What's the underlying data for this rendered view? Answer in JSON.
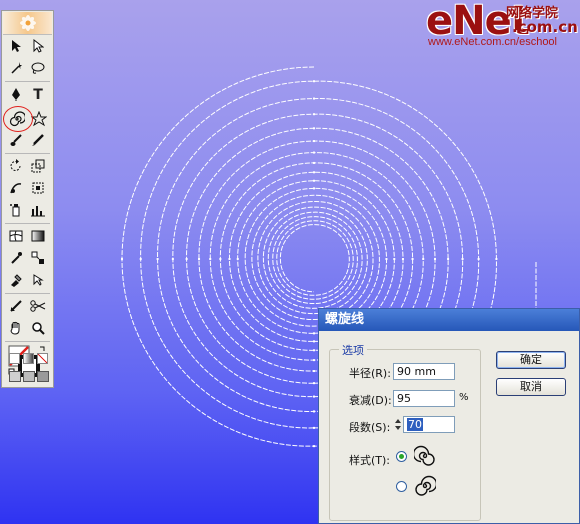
{
  "logo": {
    "brand": "eNet",
    "chinese": "网络学院",
    "domain": ".com.cn",
    "url": "www.eNet.com.cn/eschool"
  },
  "toolbox": {
    "tools": [
      {
        "name": "selection-tool",
        "icon": "arrow-icon"
      },
      {
        "name": "direct-selection-tool",
        "icon": "hollow-arrow-icon"
      },
      {
        "name": "magic-wand-tool",
        "icon": "magic-wand-icon"
      },
      {
        "name": "lasso-tool",
        "icon": "lasso-icon"
      },
      {
        "name": "pen-tool",
        "icon": "pen-icon"
      },
      {
        "name": "type-tool",
        "icon": "type-icon",
        "glyph": "T"
      },
      {
        "name": "spiral-tool",
        "icon": "spiral-icon",
        "highlighted": true
      },
      {
        "name": "star-tool",
        "icon": "star-icon"
      },
      {
        "name": "paintbrush-tool",
        "icon": "brush-icon"
      },
      {
        "name": "pencil-tool",
        "icon": "pencil-icon"
      },
      {
        "name": "rotate-tool",
        "icon": "rotate-icon"
      },
      {
        "name": "scale-tool",
        "icon": "scale-icon"
      },
      {
        "name": "warp-tool",
        "icon": "warp-icon"
      },
      {
        "name": "free-transform-tool",
        "icon": "free-transform-icon"
      },
      {
        "name": "symbol-sprayer-tool",
        "icon": "symbol-sprayer-icon"
      },
      {
        "name": "column-graph-tool",
        "icon": "graph-icon"
      },
      {
        "name": "mesh-tool",
        "icon": "mesh-icon"
      },
      {
        "name": "gradient-tool",
        "icon": "gradient-icon"
      },
      {
        "name": "eyedropper-tool",
        "icon": "eyedropper-icon"
      },
      {
        "name": "blend-tool",
        "icon": "blend-icon"
      },
      {
        "name": "live-paint-tool",
        "icon": "live-paint-icon"
      },
      {
        "name": "live-paint-selection-tool",
        "icon": "live-paint-select-icon"
      },
      {
        "name": "slice-tool",
        "icon": "slice-icon"
      },
      {
        "name": "scissors-tool",
        "icon": "scissors-icon"
      },
      {
        "name": "hand-tool",
        "icon": "hand-icon"
      },
      {
        "name": "zoom-tool",
        "icon": "zoom-icon"
      }
    ],
    "stroke_color": "#e0201c"
  },
  "dialog": {
    "title": "螺旋线",
    "group_label": "选项",
    "radius_label": "半径(R):",
    "radius_value": "90 mm",
    "decay_label": "衰减(D):",
    "decay_value": "95",
    "decay_unit": "%",
    "segments_label": "段数(S):",
    "segments_value": "70",
    "style_label": "样式(T):",
    "style_selected": "counterclockwise",
    "ok_label": "确定",
    "cancel_label": "取消"
  }
}
